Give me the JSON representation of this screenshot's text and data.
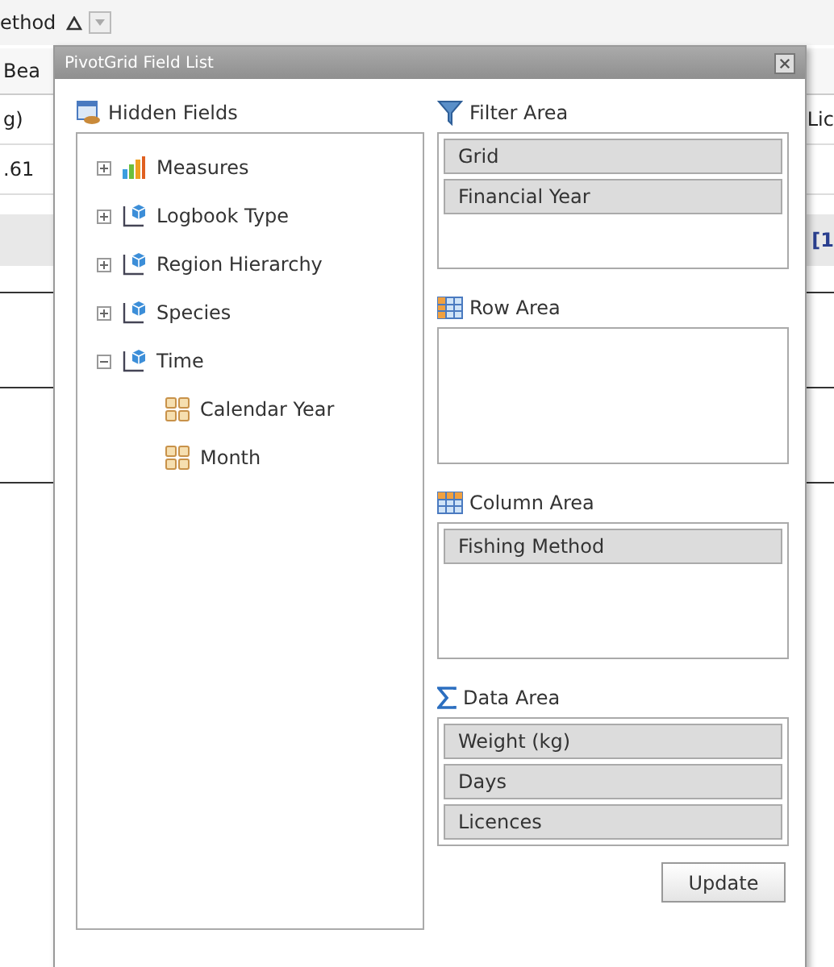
{
  "background_grid": {
    "header_text": "ethod",
    "column_header": "Bea",
    "cell_left_1": "g)",
    "cell_left_2": ".61",
    "cell_right_1": "Lic",
    "cell_right_2": "[1"
  },
  "dialog": {
    "title": "PivotGrid Field List",
    "hidden_fields": {
      "label": "Hidden Fields",
      "items": [
        {
          "label": "Measures",
          "kind": "measure",
          "expanded": false
        },
        {
          "label": "Logbook Type",
          "kind": "dimension",
          "expanded": false
        },
        {
          "label": "Region Hierarchy",
          "kind": "dimension",
          "expanded": false
        },
        {
          "label": "Species",
          "kind": "dimension",
          "expanded": false
        },
        {
          "label": "Time",
          "kind": "dimension",
          "expanded": true,
          "children": [
            {
              "label": "Calendar Year",
              "kind": "level"
            },
            {
              "label": "Month",
              "kind": "level"
            }
          ]
        }
      ]
    },
    "areas": [
      {
        "kind": "filter",
        "label": "Filter Area",
        "fields": [
          "Grid",
          "Financial Year"
        ]
      },
      {
        "kind": "row",
        "label": "Row Area"
      },
      {
        "kind": "column",
        "label": "Column Area",
        "fields": [
          "Fishing Method"
        ]
      },
      {
        "kind": "data",
        "label": "Data Area",
        "fields": [
          "Weight (kg)",
          "Days",
          "Licences"
        ]
      }
    ],
    "update_button": "Update"
  }
}
